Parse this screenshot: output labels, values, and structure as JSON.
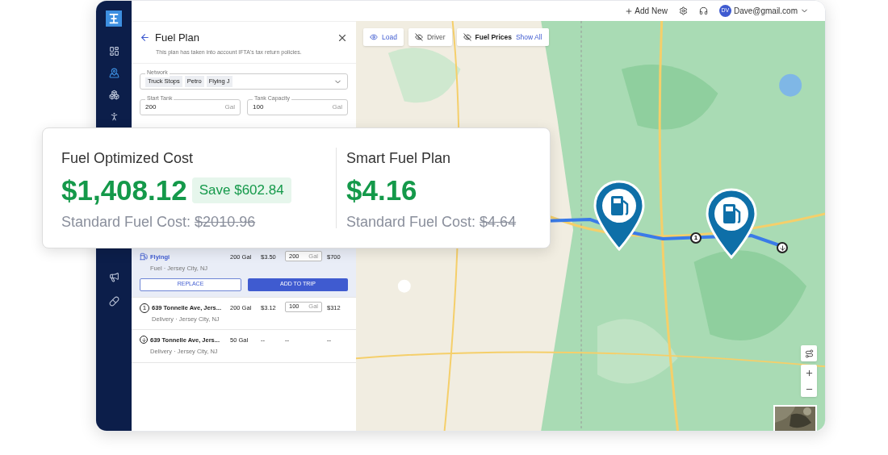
{
  "top_bar": {
    "add_new": "Add New",
    "avatar": "DV",
    "user": "Dave@gmail.com"
  },
  "map_toggles": [
    {
      "label": "Load",
      "visible": true
    },
    {
      "label": "Driver",
      "visible": false
    },
    {
      "label": "Fuel Prices",
      "visible": false,
      "link": "Show All"
    }
  ],
  "panel": {
    "title": "Fuel Plan",
    "subtitle": "This plan has taken into account IFTA's tax return policies.",
    "network": {
      "label": "Network",
      "tags": [
        "Truck Stops",
        "Petro",
        "Flying J"
      ]
    },
    "fields": [
      {
        "label": "Start Tank",
        "value": "200",
        "unit": "Gal"
      },
      {
        "label": "Tank Capacity",
        "value": "100",
        "unit": "Gal"
      }
    ],
    "stops": [
      {
        "kind": "fuel",
        "name": "Flyingi",
        "detail": "Fuel · Jersey City, NJ",
        "gallons": "200 Gal",
        "price": "$3.50",
        "amount": "200",
        "unit": "Gal",
        "total": "$700",
        "selected": true,
        "actions": [
          "REPLACE",
          "ADD TO TRIP"
        ]
      },
      {
        "kind": "numbered",
        "marker": "1",
        "name": "639 Tonnelle Ave, Jers...",
        "detail": "Delivery · Jersey City, NJ",
        "gallons": "200 Gal",
        "price": "$3.12",
        "amount": "100",
        "unit": "Gal",
        "total": "$312",
        "selected": false
      },
      {
        "kind": "end",
        "name": "639 Tonnelle Ave, Jers...",
        "detail": "Delivery · Jersey City, NJ",
        "gallons": "50 Gal",
        "price": "--",
        "amount": "--",
        "total": "--",
        "selected": false
      }
    ]
  },
  "map": {
    "route_marker": "1"
  },
  "summary": [
    {
      "title": "Fuel Optimized Cost",
      "amount": "$1,408.12",
      "badge": "Save $602.84",
      "standard_label": "Standard Fuel Cost:",
      "standard_value": "$2010.96"
    },
    {
      "title": "Smart Fuel Plan",
      "amount": "$4.16",
      "standard_label": "Standard Fuel Cost:",
      "standard_value": "$4.64"
    }
  ]
}
